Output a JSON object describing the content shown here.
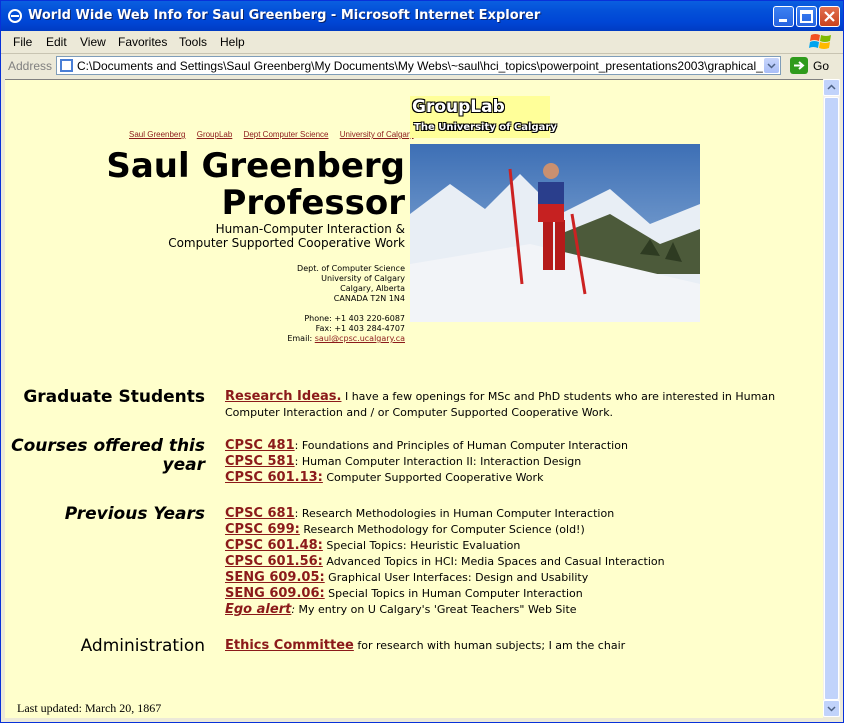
{
  "window": {
    "title": "World Wide Web Info for Saul Greenberg - Microsoft Internet Explorer"
  },
  "menu": [
    "File",
    "Edit",
    "View",
    "Favorites",
    "Tools",
    "Help"
  ],
  "address": {
    "label": "Address",
    "url": "C:\\Documents and Settings\\Saul Greenberg\\My Documents\\My Webs\\~saul\\hci_topics\\powerpoint_presentations2003\\graphical_design\\version",
    "go_label": "Go"
  },
  "page": {
    "top_links": [
      "Saul Greenberg",
      "GroupLab",
      "Dept Computer Science",
      "University of Calgary"
    ],
    "name_line1": "Saul Greenberg",
    "name_line2": "Professor",
    "subtitle_line1": "Human-Computer Interaction &",
    "subtitle_line2": "Computer Supported Cooperative Work",
    "address_lines": [
      "Dept. of Computer Science",
      "University of Calgary",
      "Calgary, Alberta",
      "CANADA T2N 1N4"
    ],
    "phone": "Phone: +1 403 220-6087",
    "fax": "Fax: +1 403 284-4707",
    "email_label": "Email:",
    "email": "saul@cpsc.ucalgary.ca",
    "grouplab_line1": "GroupLab",
    "grouplab_line2": "The University of Calgary",
    "grad": {
      "heading": "Graduate Students",
      "link": "Research Ideas.",
      "text1": " I have a few openings for MSc and PhD students who are interested in Human",
      "text2": "Computer Interaction and / or Computer Supported Cooperative Work."
    },
    "courses": {
      "heading_line1": "Courses offered this",
      "heading_line2": "year",
      "items": [
        {
          "code": "CPSC 481",
          "sep": ":",
          "desc": " Foundations and Principles of Human Computer Interaction"
        },
        {
          "code": "CPSC 581",
          "sep": ":",
          "desc": " Human Computer Interaction II: Interaction Design"
        },
        {
          "code": "CPSC 601.13:",
          "sep": "",
          "desc": " Computer Supported Cooperative Work"
        }
      ]
    },
    "previous": {
      "heading": "Previous Years",
      "items": [
        {
          "code": "CPSC 681",
          "sep": ":",
          "desc": " Research Methodologies in Human Computer Interaction"
        },
        {
          "code": "CPSC 699:",
          "sep": "",
          "desc": " Research Methodology for Computer Science (old!)"
        },
        {
          "code": "CPSC 601.48:",
          "sep": "",
          "desc": " Special Topics: Heuristic Evaluation"
        },
        {
          "code": "CPSC 601.56:",
          "sep": "",
          "desc": " Advanced Topics in HCI: Media Spaces and Casual Interaction"
        },
        {
          "code": "SENG 609.05:",
          "sep": "",
          "desc": " Graphical User Interfaces: Design and Usability"
        },
        {
          "code": "SENG 609.06:",
          "sep": "",
          "desc": " Special Topics in Human Computer Interaction"
        },
        {
          "code": "Ego alert",
          "sep": ":",
          "desc": " My entry on U Calgary's 'Great Teachers\" Web Site"
        }
      ]
    },
    "admin": {
      "heading": "Administration",
      "link": "Ethics Committee",
      "text": " for research with human subjects; I am the chair"
    },
    "last_updated": "Last updated: March 20, 1867"
  },
  "colors": {
    "page_bg": "#FFFFCC",
    "link": "#8B1A1A",
    "titlebar": "#0046D5"
  }
}
